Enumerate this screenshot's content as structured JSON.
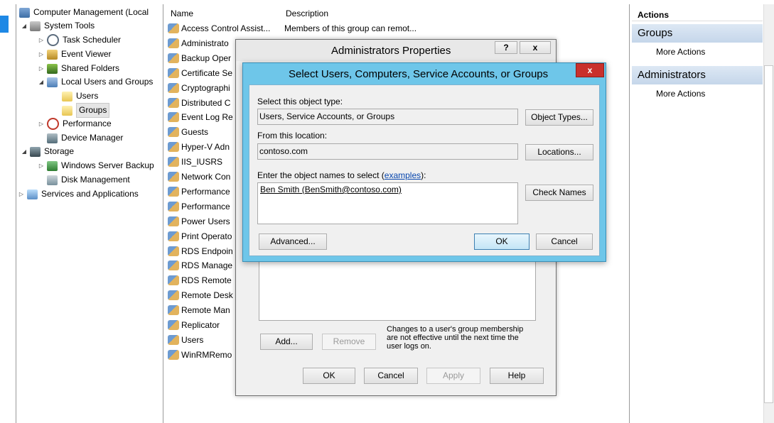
{
  "tree": {
    "items": [
      {
        "label": "Computer Management (Local",
        "icon": "computer-management-icon",
        "expander": ""
      },
      {
        "label": "System Tools",
        "icon": "system-tools-icon",
        "expander": "◢"
      },
      {
        "label": "Task Scheduler",
        "icon": "clock-icon",
        "expander": "▷"
      },
      {
        "label": "Event Viewer",
        "icon": "event-viewer-icon",
        "expander": "▷"
      },
      {
        "label": "Shared Folders",
        "icon": "shared-folders-icon",
        "expander": "▷"
      },
      {
        "label": "Local Users and Groups",
        "icon": "users-icon",
        "expander": "◢"
      },
      {
        "label": "Users",
        "icon": "folder-icon",
        "expander": ""
      },
      {
        "label": "Groups",
        "icon": "folder-icon",
        "expander": ""
      },
      {
        "label": "Performance",
        "icon": "performance-icon",
        "expander": "▷"
      },
      {
        "label": "Device Manager",
        "icon": "device-manager-icon",
        "expander": ""
      },
      {
        "label": "Storage",
        "icon": "storage-icon",
        "expander": "◢"
      },
      {
        "label": "Windows Server Backup",
        "icon": "backup-icon",
        "expander": "▷"
      },
      {
        "label": "Disk Management",
        "icon": "disk-icon",
        "expander": ""
      },
      {
        "label": "Services and Applications",
        "icon": "services-icon",
        "expander": "▷"
      }
    ]
  },
  "list": {
    "columns": [
      "Name",
      "Description"
    ],
    "rows": [
      {
        "name": "Access Control Assist...",
        "desc": "Members of this group can remot..."
      },
      {
        "name": "Administrato",
        "desc": ""
      },
      {
        "name": "Backup Oper",
        "desc": ""
      },
      {
        "name": "Certificate Se",
        "desc": ""
      },
      {
        "name": "Cryptographi",
        "desc": ""
      },
      {
        "name": "Distributed C",
        "desc": ""
      },
      {
        "name": "Event Log Re",
        "desc": ""
      },
      {
        "name": "Guests",
        "desc": ""
      },
      {
        "name": "Hyper-V Adn",
        "desc": ""
      },
      {
        "name": "IIS_IUSRS",
        "desc": ""
      },
      {
        "name": "Network Con",
        "desc": ""
      },
      {
        "name": "Performance",
        "desc": ""
      },
      {
        "name": "Performance",
        "desc": ""
      },
      {
        "name": "Power Users",
        "desc": ""
      },
      {
        "name": "Print Operato",
        "desc": ""
      },
      {
        "name": "RDS Endpoin",
        "desc": ""
      },
      {
        "name": "RDS Manage",
        "desc": ""
      },
      {
        "name": "RDS Remote",
        "desc": ""
      },
      {
        "name": "Remote Desk",
        "desc": ""
      },
      {
        "name": "Remote Man",
        "desc": ""
      },
      {
        "name": "Replicator",
        "desc": ""
      },
      {
        "name": "Users",
        "desc": ""
      },
      {
        "name": "WinRMRemo",
        "desc": ""
      }
    ]
  },
  "actions": {
    "header": "Actions",
    "sections": [
      {
        "title": "Groups",
        "item": "More Actions"
      },
      {
        "title": "Administrators",
        "item": "More Actions"
      }
    ]
  },
  "props_dialog": {
    "title": "Administrators Properties",
    "help_glyph": "?",
    "close_glyph": "x",
    "add": "Add...",
    "remove": "Remove",
    "note": "Changes to a user's group membership are not effective until the next time the user logs on.",
    "ok": "OK",
    "cancel": "Cancel",
    "apply": "Apply",
    "help": "Help"
  },
  "select_dialog": {
    "title": "Select Users, Computers, Service Accounts, or Groups",
    "close_glyph": "x",
    "object_type_label": "Select this object type:",
    "object_type_value": "Users, Service Accounts, or Groups",
    "object_types_button": "Object Types...",
    "location_label": "From this location:",
    "location_value": "contoso.com",
    "locations_button": "Locations...",
    "names_label_prefix": "Enter the object names to select (",
    "names_label_link": "examples",
    "names_label_suffix": "):",
    "names_value": "Ben Smith (BenSmith@contoso.com)",
    "check_names_button": "Check Names",
    "advanced_button": "Advanced...",
    "ok": "OK",
    "cancel": "Cancel"
  },
  "colors": {
    "accent": "#1e88e5",
    "dialog_frame": "#6ec6e9",
    "close_red": "#c9302c",
    "action_section": "#c5d6ea"
  }
}
